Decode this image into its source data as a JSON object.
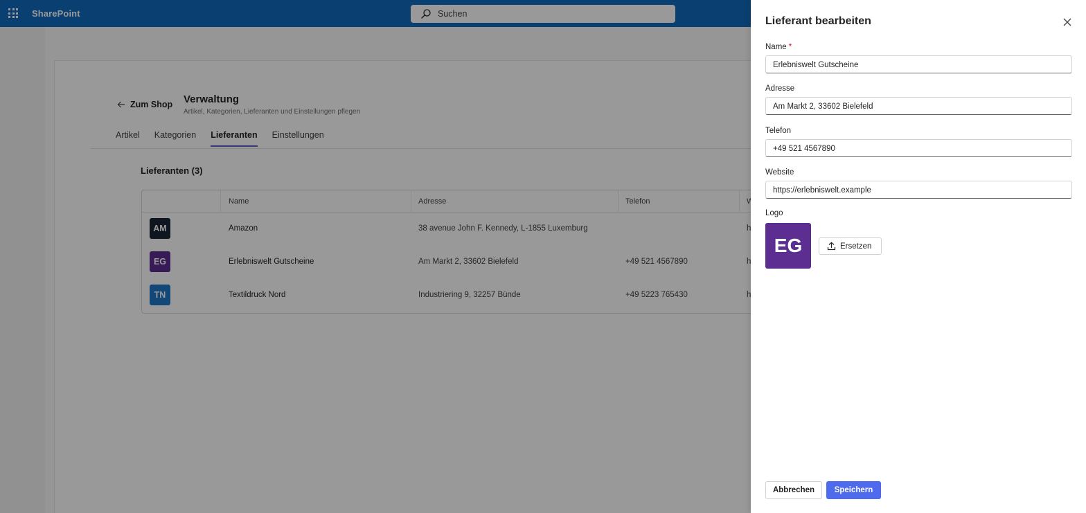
{
  "suite": {
    "app_name": "SharePoint",
    "search_placeholder": "Suchen",
    "accent": "#0f6cbd"
  },
  "page": {
    "back_label": "Zum Shop",
    "title": "Verwaltung",
    "subtitle": "Artikel, Kategorien, Lieferanten und Einstellungen pflegen",
    "tabs": [
      {
        "label": "Artikel",
        "active": false
      },
      {
        "label": "Kategorien",
        "active": false
      },
      {
        "label": "Lieferanten",
        "active": true
      },
      {
        "label": "Einstellungen",
        "active": false
      }
    ],
    "section_title": "Lieferanten (3)",
    "table": {
      "columns": [
        "",
        "Name",
        "Adresse",
        "Telefon",
        "W"
      ],
      "rows": [
        {
          "initials": "AM",
          "color": "#1b2536",
          "name": "Amazon",
          "address": "38 avenue John F. Kennedy, L-1855 Luxemburg",
          "phone": "",
          "website": "h"
        },
        {
          "initials": "EG",
          "color": "#5c2e91",
          "name": "Erlebniswelt Gutscheine",
          "address": "Am Markt 2, 33602 Bielefeld",
          "phone": "+49 521 4567890",
          "website": "h"
        },
        {
          "initials": "TN",
          "color": "#1f77c9",
          "name": "Textildruck Nord",
          "address": "Industriering 9, 32257 Bünde",
          "phone": "+49 5223 765430",
          "website": "h"
        }
      ]
    }
  },
  "panel": {
    "title": "Lieferant bearbeiten",
    "fields": {
      "name": {
        "label": "Name",
        "required_mark": "*",
        "value": "Erlebniswelt Gutscheine"
      },
      "address": {
        "label": "Adresse",
        "value": "Am Markt 2, 33602 Bielefeld"
      },
      "phone": {
        "label": "Telefon",
        "value": "+49 521 4567890"
      },
      "website": {
        "label": "Website",
        "value": "https://erlebniswelt.example"
      }
    },
    "logo": {
      "label": "Logo",
      "initials": "EG",
      "color": "#5c2e91",
      "replace_label": "Ersetzen"
    },
    "cancel_label": "Abbrechen",
    "save_label": "Speichern",
    "save_color": "#4f6bed"
  }
}
